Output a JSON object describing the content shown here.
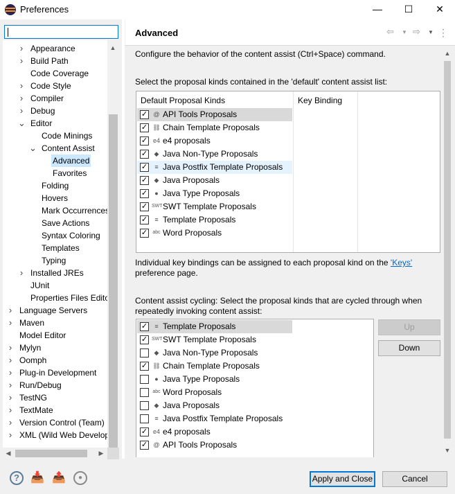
{
  "window": {
    "title": "Preferences",
    "minimize": "—",
    "maximize": "☐",
    "close": "✕"
  },
  "filter": {
    "value": ""
  },
  "tree": {
    "items": [
      {
        "label": "Appearance",
        "indent": 2,
        "twisty": ">"
      },
      {
        "label": "Build Path",
        "indent": 2,
        "twisty": ">"
      },
      {
        "label": "Code Coverage",
        "indent": 2,
        "twisty": ""
      },
      {
        "label": "Code Style",
        "indent": 2,
        "twisty": ">"
      },
      {
        "label": "Compiler",
        "indent": 2,
        "twisty": ">"
      },
      {
        "label": "Debug",
        "indent": 2,
        "twisty": ">"
      },
      {
        "label": "Editor",
        "indent": 2,
        "twisty": "v"
      },
      {
        "label": "Code Minings",
        "indent": 3,
        "twisty": ""
      },
      {
        "label": "Content Assist",
        "indent": 3,
        "twisty": "v"
      },
      {
        "label": "Advanced",
        "indent": 4,
        "twisty": "",
        "selected": true
      },
      {
        "label": "Favorites",
        "indent": 4,
        "twisty": ""
      },
      {
        "label": "Folding",
        "indent": 3,
        "twisty": ""
      },
      {
        "label": "Hovers",
        "indent": 3,
        "twisty": ""
      },
      {
        "label": "Mark Occurrences",
        "indent": 3,
        "twisty": ""
      },
      {
        "label": "Save Actions",
        "indent": 3,
        "twisty": ""
      },
      {
        "label": "Syntax Coloring",
        "indent": 3,
        "twisty": ""
      },
      {
        "label": "Templates",
        "indent": 3,
        "twisty": ""
      },
      {
        "label": "Typing",
        "indent": 3,
        "twisty": ""
      },
      {
        "label": "Installed JREs",
        "indent": 2,
        "twisty": ">"
      },
      {
        "label": "JUnit",
        "indent": 2,
        "twisty": ""
      },
      {
        "label": "Properties Files Editor",
        "indent": 2,
        "twisty": ""
      },
      {
        "label": "Language Servers",
        "indent": 1,
        "twisty": ">"
      },
      {
        "label": "Maven",
        "indent": 1,
        "twisty": ">"
      },
      {
        "label": "Model Editor",
        "indent": 1,
        "twisty": ""
      },
      {
        "label": "Mylyn",
        "indent": 1,
        "twisty": ">"
      },
      {
        "label": "Oomph",
        "indent": 1,
        "twisty": ">"
      },
      {
        "label": "Plug-in Development",
        "indent": 1,
        "twisty": ">"
      },
      {
        "label": "Run/Debug",
        "indent": 1,
        "twisty": ">"
      },
      {
        "label": "TestNG",
        "indent": 1,
        "twisty": ">"
      },
      {
        "label": "TextMate",
        "indent": 1,
        "twisty": ">"
      },
      {
        "label": "Version Control (Team)",
        "indent": 1,
        "twisty": ">"
      },
      {
        "label": "XML (Wild Web Developer)",
        "indent": 1,
        "twisty": ">"
      }
    ]
  },
  "page": {
    "title": "Advanced",
    "description": "Configure the behavior of the content assist (Ctrl+Space) command.",
    "default_list_label": "Select the proposal kinds contained in the 'default' content assist list:",
    "col_kinds": "Default Proposal Kinds",
    "col_binding": "Key Binding",
    "default_proposals": [
      {
        "label": "API Tools Proposals",
        "checked": true,
        "icon": "api-tools-icon",
        "glyph": "@"
      },
      {
        "label": "Chain Template Proposals",
        "checked": true,
        "icon": "chain-template-icon",
        "glyph": "⛓"
      },
      {
        "label": "e4 proposals",
        "checked": true,
        "icon": "e4-icon",
        "glyph": "e4"
      },
      {
        "label": "Java Non-Type Proposals",
        "checked": true,
        "icon": "java-non-type-icon",
        "glyph": "◆"
      },
      {
        "label": "Java Postfix Template Proposals",
        "checked": true,
        "icon": "postfix-template-icon",
        "glyph": "≡"
      },
      {
        "label": "Java Proposals",
        "checked": true,
        "icon": "java-proposals-icon",
        "glyph": "◆"
      },
      {
        "label": "Java Type Proposals",
        "checked": true,
        "icon": "java-type-icon",
        "glyph": "●"
      },
      {
        "label": "SWT Template Proposals",
        "checked": true,
        "icon": "swt-template-icon",
        "glyph": "SWT"
      },
      {
        "label": "Template Proposals",
        "checked": true,
        "icon": "template-icon",
        "glyph": "≡"
      },
      {
        "label": "Word Proposals",
        "checked": true,
        "icon": "word-icon",
        "glyph": "abc"
      }
    ],
    "keys_note_prefix": "Individual key bindings can be assigned to each proposal kind on the ",
    "keys_link": "'Keys'",
    "keys_note_suffix": "preference page.",
    "cycling_line1": "Content assist cycling: Select the proposal kinds that are cycled through when",
    "cycling_line2": "repeatedly invoking content assist:",
    "cycling_proposals": [
      {
        "label": "Template Proposals",
        "checked": true,
        "icon": "template-icon",
        "glyph": "≡"
      },
      {
        "label": "SWT Template Proposals",
        "checked": true,
        "icon": "swt-template-icon",
        "glyph": "SWT"
      },
      {
        "label": "Java Non-Type Proposals",
        "checked": false,
        "icon": "java-non-type-icon",
        "glyph": "◆"
      },
      {
        "label": "Chain Template Proposals",
        "checked": true,
        "icon": "chain-template-icon",
        "glyph": "⛓"
      },
      {
        "label": "Java Type Proposals",
        "checked": false,
        "icon": "java-type-icon",
        "glyph": "●"
      },
      {
        "label": "Word Proposals",
        "checked": false,
        "icon": "word-icon",
        "glyph": "abc"
      },
      {
        "label": "Java Proposals",
        "checked": false,
        "icon": "java-proposals-icon",
        "glyph": "◆"
      },
      {
        "label": "Java Postfix Template Proposals",
        "checked": false,
        "icon": "postfix-template-icon",
        "glyph": "≡"
      },
      {
        "label": "e4 proposals",
        "checked": true,
        "icon": "e4-icon",
        "glyph": "e4"
      },
      {
        "label": "API Tools Proposals",
        "checked": true,
        "icon": "api-tools-icon",
        "glyph": "@"
      }
    ],
    "up_label": "Up",
    "down_label": "Down"
  },
  "buttons": {
    "apply_close": "Apply and Close",
    "cancel": "Cancel"
  },
  "colors": {
    "accent": "#0078d7",
    "selection": "#cce8ff",
    "link": "#0066cc"
  }
}
